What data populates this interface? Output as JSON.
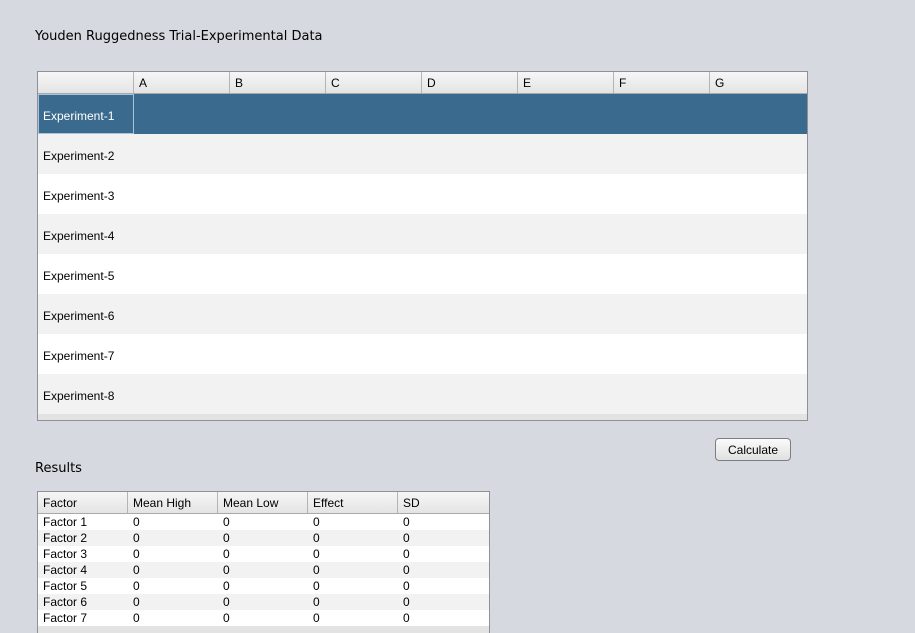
{
  "title": "Youden Ruggedness Trial-Experimental Data",
  "experiment_table": {
    "columns": [
      "A",
      "B",
      "C",
      "D",
      "E",
      "F",
      "G"
    ],
    "rows": [
      "Experiment-1",
      "Experiment-2",
      "Experiment-3",
      "Experiment-4",
      "Experiment-5",
      "Experiment-6",
      "Experiment-7",
      "Experiment-8"
    ],
    "selected_row": 0
  },
  "calculate_label": "Calculate",
  "results_label": "Results",
  "results_table": {
    "columns": [
      "Factor",
      "Mean High",
      "Mean Low",
      "Effect",
      "SD"
    ],
    "rows": [
      [
        "Factor 1",
        "0",
        "0",
        "0",
        "0"
      ],
      [
        "Factor 2",
        "0",
        "0",
        "0",
        "0"
      ],
      [
        "Factor 3",
        "0",
        "0",
        "0",
        "0"
      ],
      [
        "Factor 4",
        "0",
        "0",
        "0",
        "0"
      ],
      [
        "Factor 5",
        "0",
        "0",
        "0",
        "0"
      ],
      [
        "Factor 6",
        "0",
        "0",
        "0",
        "0"
      ],
      [
        "Factor 7",
        "0",
        "0",
        "0",
        "0"
      ]
    ]
  },
  "colors": {
    "selection": "#3a6b8e",
    "background": "#d6d9df"
  }
}
